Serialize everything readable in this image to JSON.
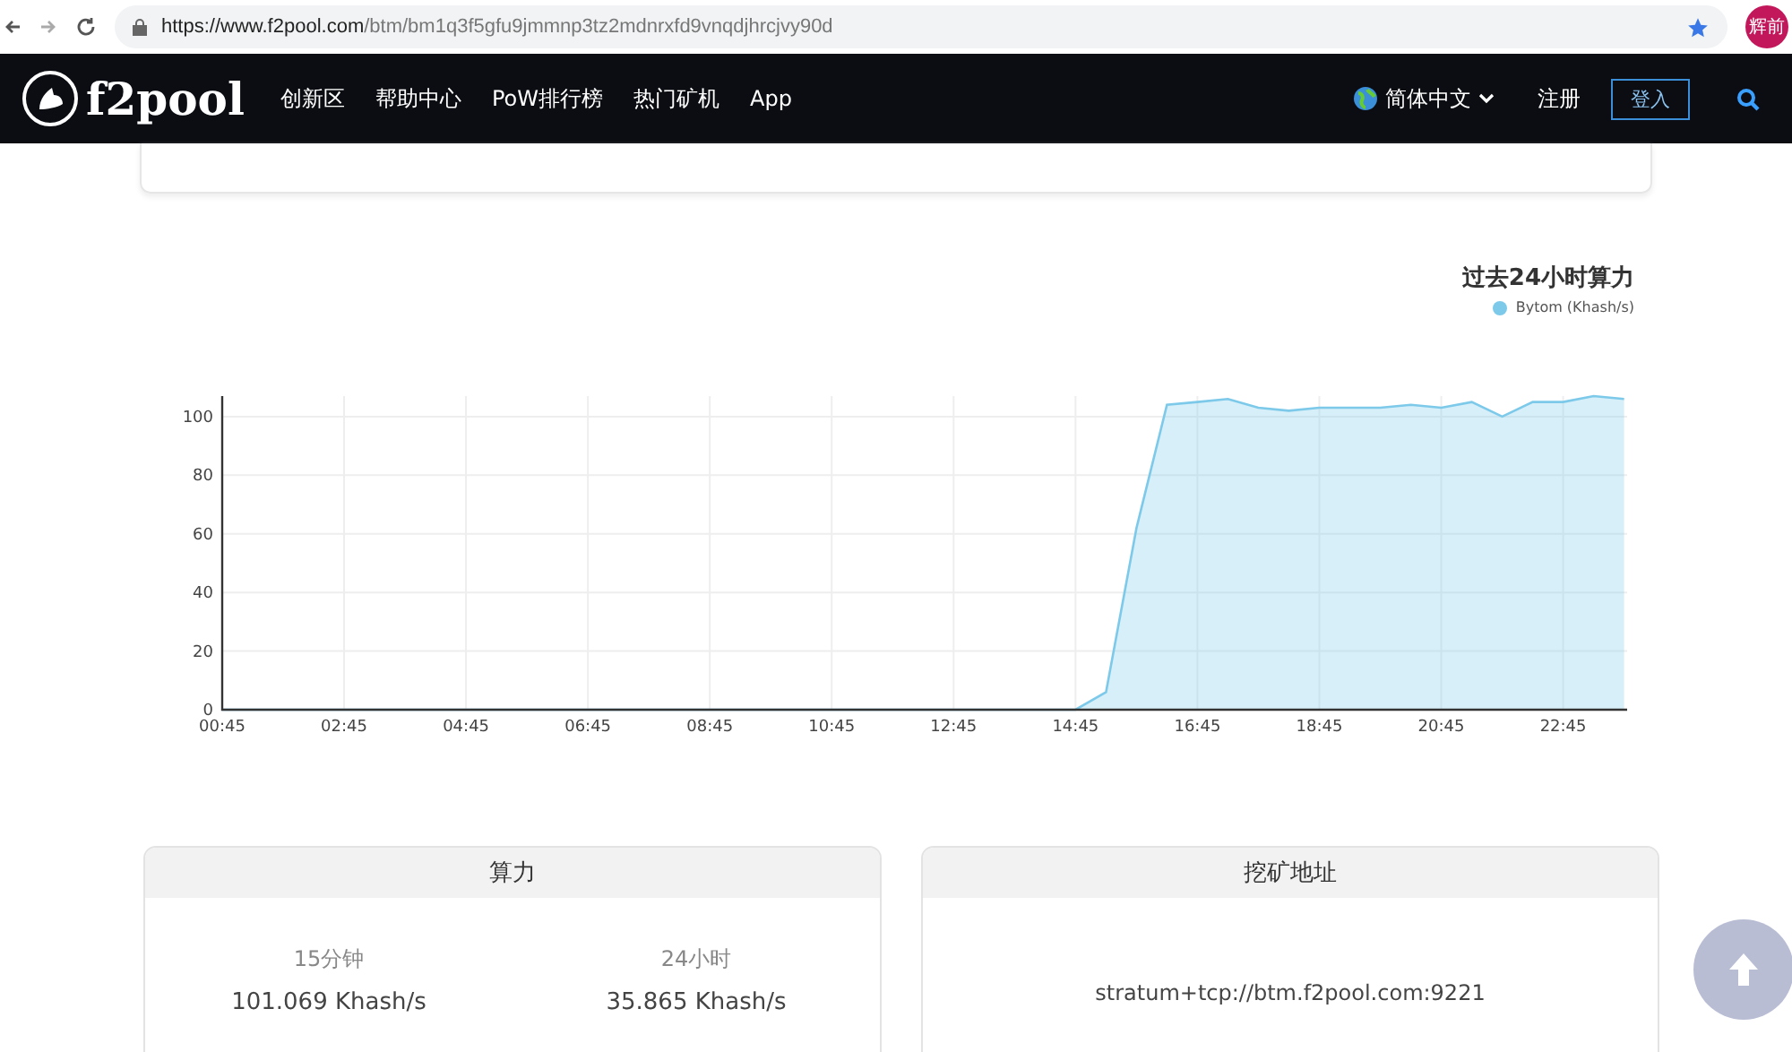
{
  "browser": {
    "url_host": "https://www.f2pool.com",
    "url_path": "/btm/bm1q3f5gfu9jmmnp3tz2mdnrxfd9vnqdjhrcjvy90d",
    "profile": "辉前"
  },
  "nav": {
    "logo": "f2pool",
    "links": [
      "创新区",
      "帮助中心",
      "PoW排行榜",
      "热门矿机",
      "App"
    ],
    "language": "简体中文",
    "register": "注册",
    "login": "登入"
  },
  "chart": {
    "chart_data": {
      "type": "area",
      "title": "过去24小时算力",
      "categories": [
        "00:45",
        null,
        null,
        null,
        "02:45",
        null,
        null,
        null,
        "04:45",
        null,
        null,
        null,
        "06:45",
        null,
        null,
        null,
        "08:45",
        null,
        null,
        null,
        "10:45",
        null,
        null,
        null,
        "12:45",
        null,
        null,
        null,
        "14:45",
        null,
        null,
        null,
        "16:45",
        null,
        null,
        null,
        "18:45",
        null,
        null,
        null,
        "20:45",
        null,
        null,
        null,
        "22:45",
        null,
        null
      ],
      "series": [
        {
          "name": "Bytom (Khash/s)",
          "color": "#7cc9ea",
          "values": [
            0,
            0,
            0,
            0,
            0,
            0,
            0,
            0,
            0,
            0,
            0,
            0,
            0,
            0,
            0,
            0,
            0,
            0,
            0,
            0,
            0,
            0,
            0,
            0,
            0,
            0,
            0,
            0,
            0,
            6,
            62,
            104,
            105,
            106,
            103,
            102,
            103,
            103,
            103,
            104,
            103,
            105,
            100,
            105,
            105,
            107,
            106
          ]
        }
      ],
      "ylim": [
        0,
        107
      ],
      "grid": true,
      "yticks": [
        0,
        20,
        40,
        60,
        80,
        100
      ]
    }
  },
  "hashrate": {
    "title": "算力",
    "stats": [
      {
        "label": "15分钟",
        "value": "101.069 Khash/s"
      },
      {
        "label": "24小时",
        "value": "35.865 Khash/s"
      }
    ]
  },
  "address": {
    "title": "挖矿地址",
    "value": "stratum+tcp://btm.f2pool.com:9221"
  }
}
